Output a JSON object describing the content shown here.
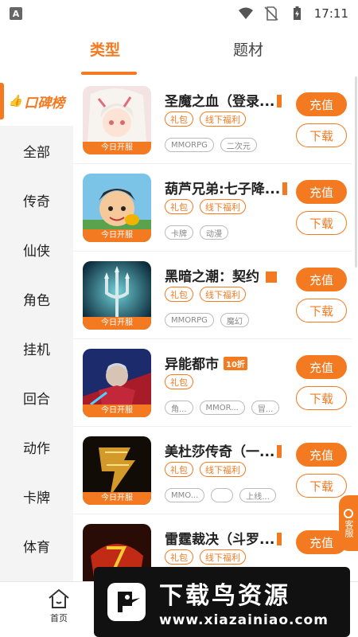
{
  "status_bar": {
    "time": "17:11",
    "notif_letter": "A"
  },
  "tabs": [
    {
      "label": "类型"
    },
    {
      "label": "题材"
    }
  ],
  "sidebar": {
    "items": [
      {
        "label": "口碑榜"
      },
      {
        "label": "全部"
      },
      {
        "label": "传奇"
      },
      {
        "label": "仙侠"
      },
      {
        "label": "角色"
      },
      {
        "label": "挂机"
      },
      {
        "label": "回合"
      },
      {
        "label": "动作"
      },
      {
        "label": "卡牌"
      },
      {
        "label": "体育"
      }
    ]
  },
  "games": [
    {
      "title": "圣魔之血（登录...",
      "open_label": "今日开服",
      "tags": [
        "礼包",
        "线下福利"
      ],
      "genres": [
        "MMORPG",
        "二次元"
      ],
      "charge": "充值",
      "download": "下载"
    },
    {
      "title": "葫芦兄弟:七子降...",
      "open_label": "今日开服",
      "tags": [
        "礼包",
        "线下福利"
      ],
      "genres": [
        "卡牌",
        "动漫"
      ],
      "charge": "充值",
      "download": "下载"
    },
    {
      "title": "黑暗之潮：契约",
      "open_label": "今日开服",
      "tags": [
        "礼包",
        "线下福利"
      ],
      "genres": [
        "MMORPG",
        "魔幻"
      ],
      "charge": "充值",
      "download": "下载"
    },
    {
      "title": "异能都市",
      "badge": "10折",
      "open_label": "今日开服",
      "tags": [
        "礼包"
      ],
      "genres": [
        "角...",
        "MMOR...",
        "冒..."
      ],
      "charge": "充值",
      "download": "下载"
    },
    {
      "title": "美杜莎传奇（一...",
      "open_label": "今日开服",
      "tags": [
        "礼包",
        "线下福利"
      ],
      "genres": [
        "MMO...",
        "",
        "上线..."
      ],
      "charge": "充值",
      "download": "下载"
    },
    {
      "title": "雷霆裁决（斗罗...",
      "tags": [
        "礼包",
        "线下福利"
      ],
      "charge": "充值"
    }
  ],
  "service": {
    "label": "客服"
  },
  "bottom_nav": {
    "home_label": "首页"
  },
  "watermark": {
    "title": "下载鸟资源",
    "url": "www.xiazainiao.com"
  },
  "colors": {
    "accent": "#f47a22"
  }
}
